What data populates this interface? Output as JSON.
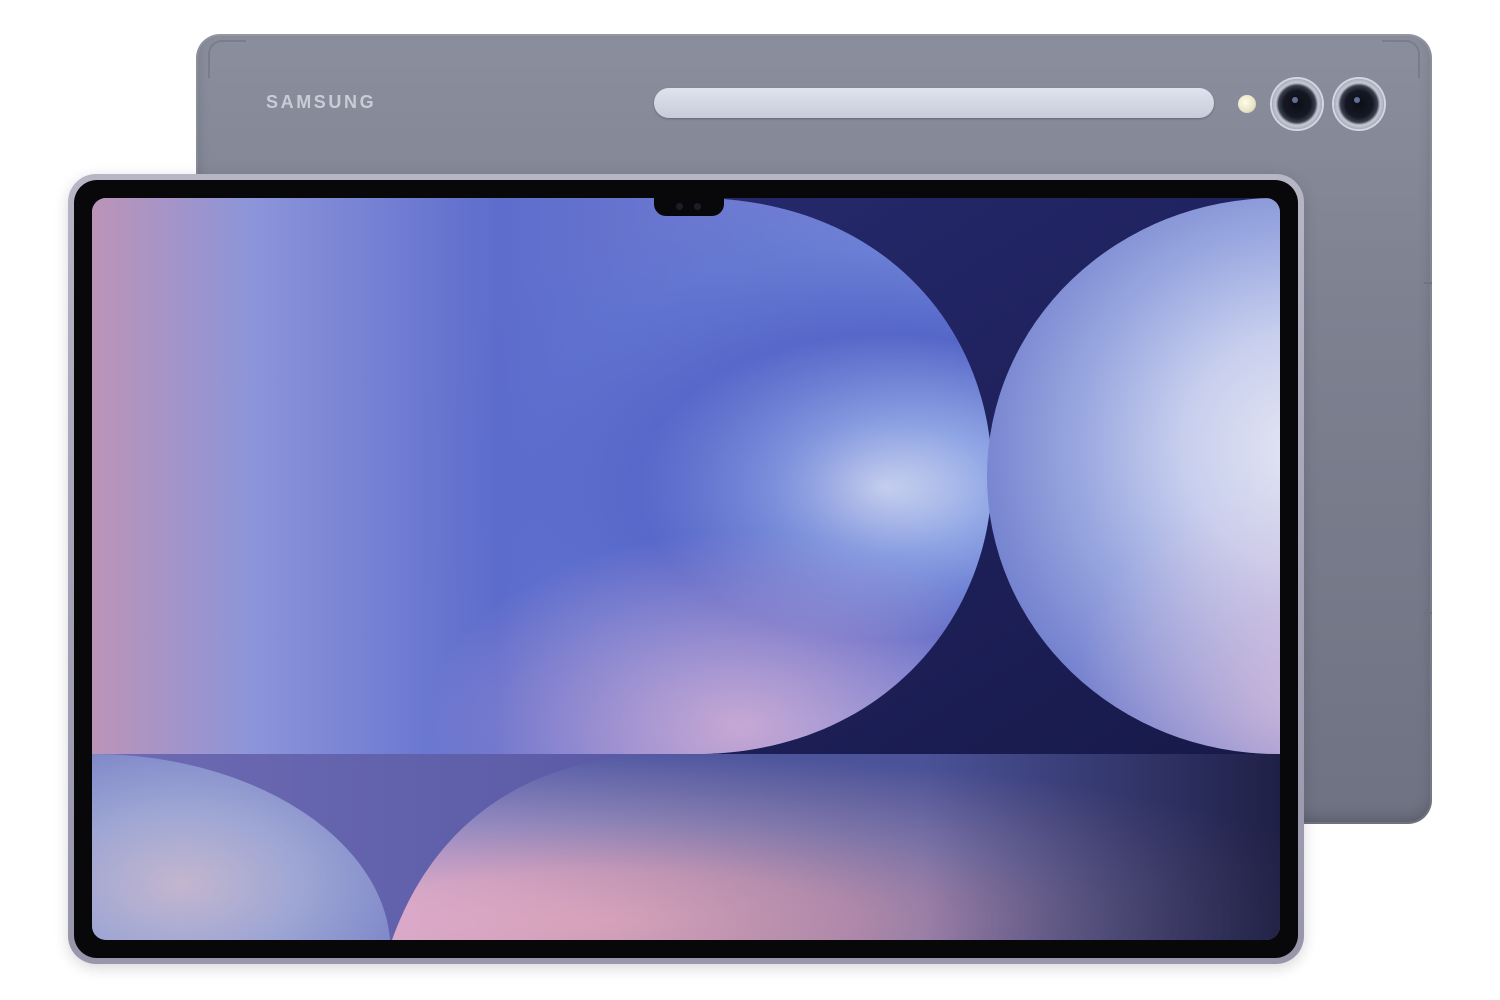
{
  "device": {
    "brand": "SAMSUNG",
    "colors": {
      "back_panel": "#7d8190",
      "frame": "#a4a3b6",
      "spen_strip": "#d4d8e5",
      "wallpaper_deep": "#17194e",
      "wallpaper_blue": "#5562c4",
      "wallpaper_pink": "#d9a8c6",
      "wallpaper_light": "#dfe2f0"
    },
    "icons": [
      "camera-lens-icon",
      "camera-lens-icon",
      "flash-icon"
    ]
  }
}
